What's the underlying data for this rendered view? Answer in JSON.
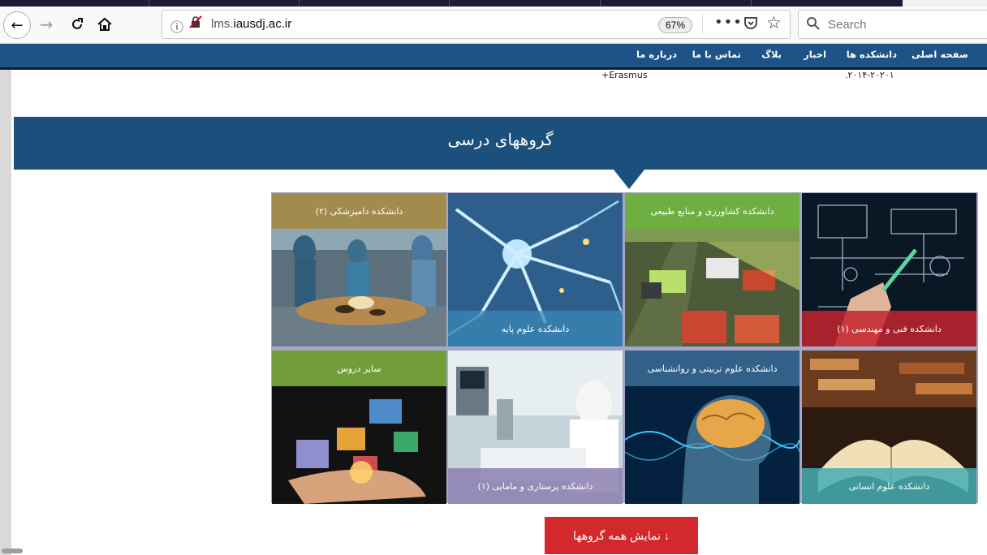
{
  "browser": {
    "url_prefix": "lms.",
    "url_domain": "iausdj.ac.ir",
    "zoom": "67%",
    "search_placeholder": "Search",
    "icons": [
      "back-arrow-icon",
      "forward-arrow-icon",
      "reload-icon",
      "home-icon",
      "info-icon",
      "insecure-lock-icon",
      "more-icon",
      "pocket-icon",
      "star-icon",
      "search-icon"
    ]
  },
  "site_nav": {
    "items": [
      "صفحه اصلی",
      "دانشکده ها",
      "اخبار",
      "بلاگ",
      "تماس با ما",
      "درباره ما"
    ]
  },
  "previous_section": {
    "left_text": "+Erasmus",
    "right_text": ".۲۰۱۴-۲۰۲۰۱"
  },
  "section": {
    "title": "گروههای درسی"
  },
  "groups": [
    {
      "label": "دانشکده دامپزشکی (۲)",
      "band_color": "#a5873c"
    },
    {
      "label": "دانشکده علوم پایه",
      "band_color": "#3b87b6"
    },
    {
      "label": "دانشکده کشاورزی و منابع طبیعی",
      "band_color": "#6cb33f"
    },
    {
      "label": "دانشکده فنی و مهندسی (۱)",
      "band_color": "#c4252f"
    },
    {
      "label": "سایر دروس",
      "band_color": "#7dae3e"
    },
    {
      "label": "دانشکده پرستاری و مامایی (۱)",
      "band_color": "#8b7fb0"
    },
    {
      "label": "دانشکده علوم تربیتی و روانشناسی",
      "band_color": "#3a6c96"
    },
    {
      "label": "دانشکده علوم انسانی",
      "band_color": "#44afb3"
    }
  ],
  "show_all_button": {
    "label": "نمایش همه گروهها",
    "icon": "arrow-down-icon"
  }
}
